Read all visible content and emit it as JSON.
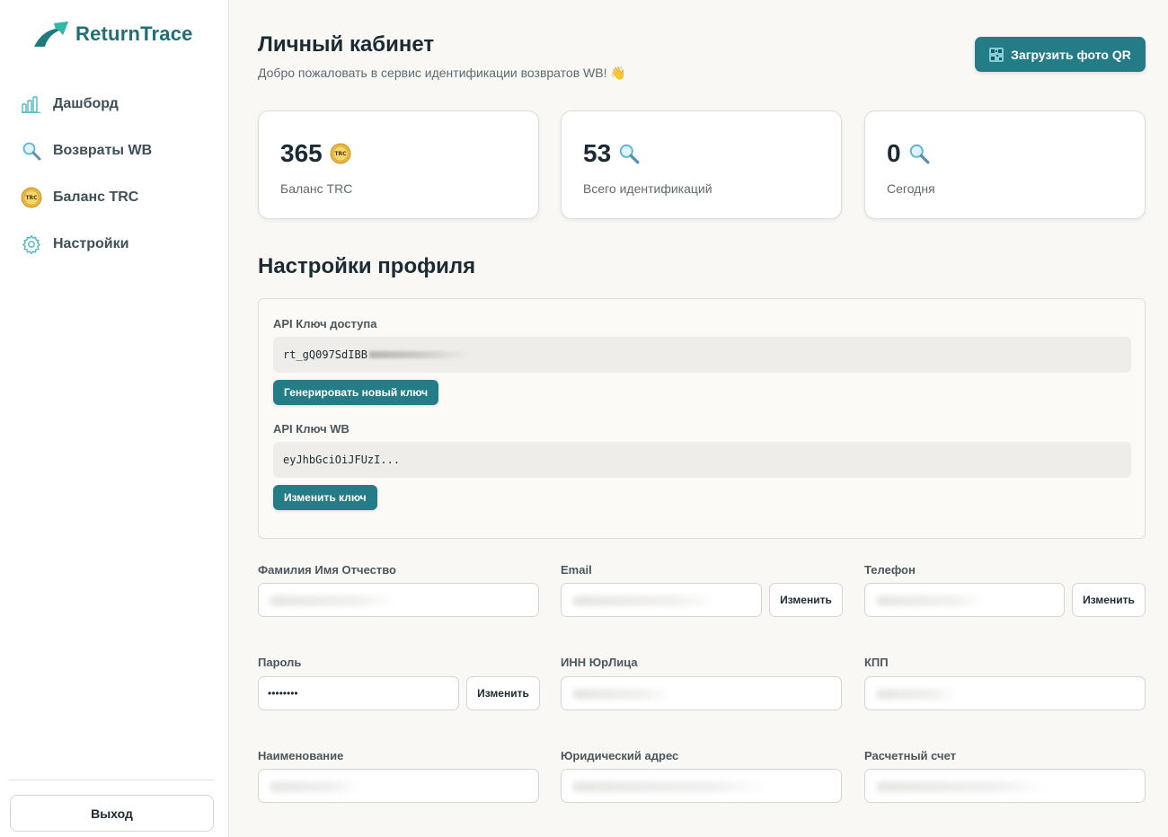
{
  "app": {
    "name": "ReturnTrace",
    "brand_color": "#1f6e78",
    "accent_color": "#247d86"
  },
  "sidebar": {
    "items": [
      {
        "label": "Дашборд",
        "icon": "bar-chart-icon"
      },
      {
        "label": "Возвраты WB",
        "icon": "magnifier-icon"
      },
      {
        "label": "Баланс TRC",
        "icon": "trc-coin-icon"
      },
      {
        "label": "Настройки",
        "icon": "gear-icon"
      }
    ],
    "logout_label": "Выход"
  },
  "header": {
    "title": "Личный кабинет",
    "subtitle": "Добро пожаловать в сервис идентификации возвратов WB! 👋",
    "upload_label": "Загрузить фото QR"
  },
  "stats": [
    {
      "value": "365",
      "label": "Баланс TRC",
      "icon": "trc-coin-icon"
    },
    {
      "value": "53",
      "label": "Всего идентификаций",
      "icon": "magnifier-icon"
    },
    {
      "value": "0",
      "label": "Сегодня",
      "icon": "magnifier-icon"
    }
  ],
  "profile": {
    "title": "Настройки профиля",
    "api": {
      "access_key_label": "API Ключ доступа",
      "access_key_value": "rt_gQ097SdIBB",
      "generate_label": "Генерировать новый ключ",
      "wb_key_label": "API Ключ WB",
      "wb_key_value": "eyJhbGciOiJFUzI...",
      "change_key_label": "Изменить ключ"
    },
    "fields": {
      "fio_label": "Фамилия Имя Отчество",
      "email_label": "Email",
      "phone_label": "Телефон",
      "password_label": "Пароль",
      "password_value": "••••••••",
      "inn_label": "ИНН ЮрЛица",
      "kpp_label": "КПП",
      "name_label": "Наименование",
      "address_label": "Юридический адрес",
      "account_label": "Расчетный счет",
      "change_label": "Изменить"
    }
  }
}
